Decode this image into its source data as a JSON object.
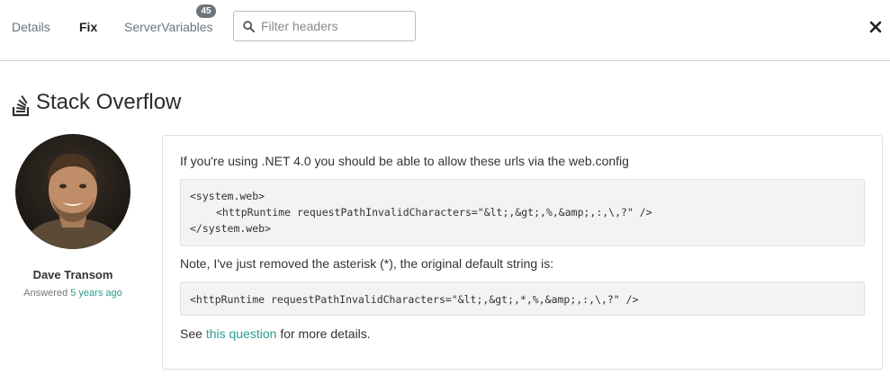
{
  "tabs": {
    "details": "Details",
    "fix": "Fix",
    "server_variables": "ServerVariables",
    "server_variables_count": "45"
  },
  "filter": {
    "placeholder": "Filter headers",
    "value": ""
  },
  "icons": {
    "search": "search-icon",
    "close": "close-icon",
    "stackoverflow": "stackoverflow-icon"
  },
  "heading": "Stack Overflow",
  "author": {
    "name": "Dave Transom",
    "answered_prefix": "Answered",
    "answered_time": "5 years ago"
  },
  "answer": {
    "intro": "If you're using .NET 4.0 you should be able to allow these urls via the web.config",
    "code1": {
      "line1": "<system.web>",
      "line2": "<httpRuntime requestPathInvalidCharacters=\"&lt;,&gt;,%,&amp;,:,\\,?\" />",
      "line3": "</system.web>"
    },
    "note": "Note, I've just removed the asterisk (*), the original default string is:",
    "code2": "<httpRuntime requestPathInvalidCharacters=\"&lt;,&gt;,*,%,&amp;,:,\\,?\" />",
    "see_prefix": "See",
    "link": "this question",
    "see_suffix": "for more details."
  },
  "colors": {
    "link": "#2a9d8f",
    "badge": "#6c757d",
    "border": "#dcdcdc"
  }
}
